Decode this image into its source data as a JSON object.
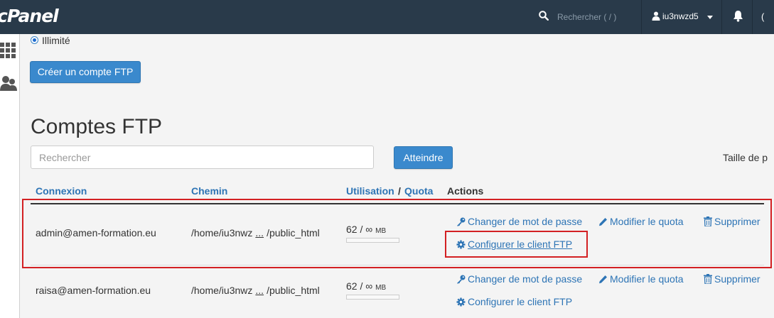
{
  "topbar": {
    "logo": "cPanel",
    "search_placeholder": "Rechercher ( / )",
    "username": "iu3nwzd5"
  },
  "quota_option": {
    "label": "Illimité",
    "selected": true
  },
  "create_button": "Créer un compte FTP",
  "title": "Comptes FTP",
  "search": {
    "placeholder": "Rechercher",
    "value": ""
  },
  "go_button": "Atteindre",
  "page_size_label": "Taille de p",
  "table": {
    "headers": {
      "login": "Connexion",
      "path": "Chemin",
      "usage": "Utilisation",
      "slash": "/",
      "quota": "Quota",
      "actions": "Actions"
    },
    "rows": [
      {
        "login": "admin@amen-formation.eu",
        "path_start": "/home/iu3nwz",
        "ellipsis": "...",
        "path_end": "/public_html",
        "usage": "62",
        "quota": "∞",
        "unit": "MB",
        "usage_fraction": 0
      },
      {
        "login": "raisa@amen-formation.eu",
        "path_start": "/home/iu3nwz",
        "ellipsis": "...",
        "path_end": "/public_html",
        "usage": "62",
        "quota": "∞",
        "unit": "MB",
        "usage_fraction": 0
      }
    ],
    "actions": {
      "change_password": "Changer de mot de passe",
      "edit_quota": "Modifier le quota",
      "delete": "Supprimer",
      "configure": "Configurer le client FTP"
    }
  },
  "colors": {
    "topbar": "#293a4a",
    "link": "#2d74b5",
    "button": "#3a89cd",
    "highlight": "#d32023"
  }
}
